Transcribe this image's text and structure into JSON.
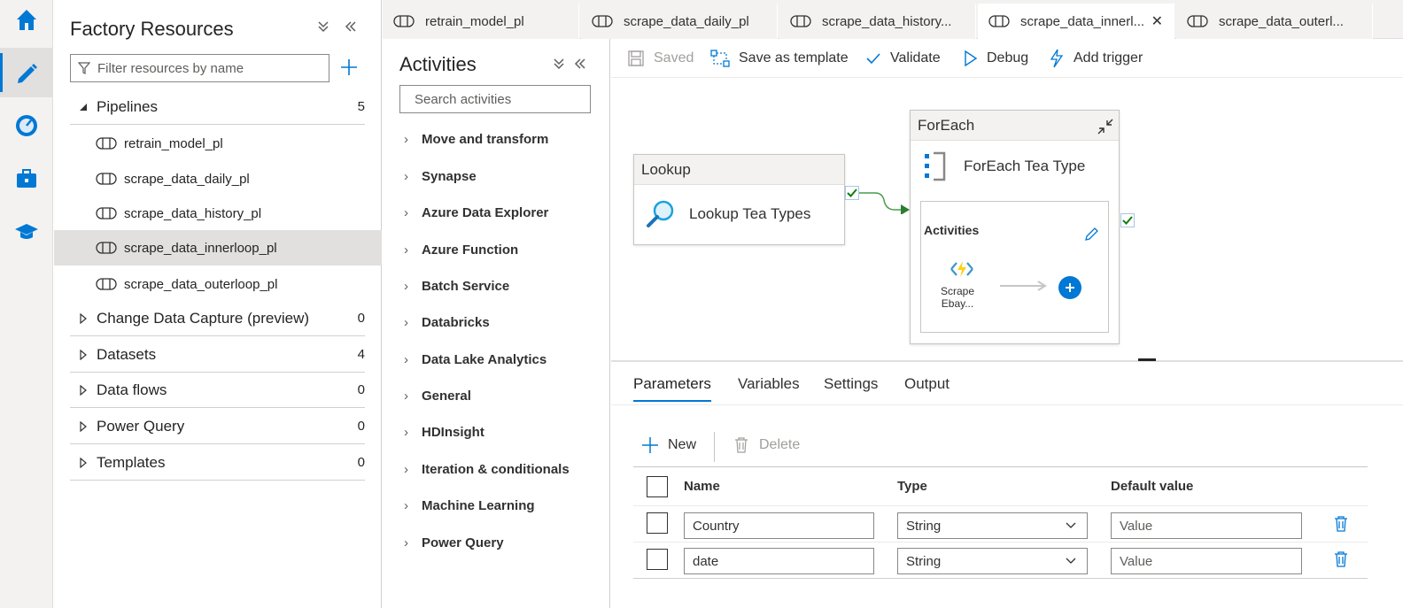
{
  "resources": {
    "title": "Factory Resources",
    "filter_placeholder": "Filter resources by name",
    "pipelines": {
      "label": "Pipelines",
      "count": "5",
      "items": [
        "retrain_model_pl",
        "scrape_data_daily_pl",
        "scrape_data_history_pl",
        "scrape_data_innerloop_pl",
        "scrape_data_outerloop_pl"
      ]
    },
    "categories": [
      {
        "label": "Change Data Capture (preview)",
        "count": "0"
      },
      {
        "label": "Datasets",
        "count": "4"
      },
      {
        "label": "Data flows",
        "count": "0"
      },
      {
        "label": "Power Query",
        "count": "0"
      },
      {
        "label": "Templates",
        "count": "0"
      }
    ]
  },
  "tabs": [
    "retrain_model_pl",
    "scrape_data_daily_pl",
    "scrape_data_history...",
    "scrape_data_innerl...",
    "scrape_data_outerl..."
  ],
  "activities": {
    "title": "Activities",
    "search_placeholder": "Search activities",
    "categories": [
      "Move and transform",
      "Synapse",
      "Azure Data Explorer",
      "Azure Function",
      "Batch Service",
      "Databricks",
      "Data Lake Analytics",
      "General",
      "HDInsight",
      "Iteration & conditionals",
      "Machine Learning",
      "Power Query"
    ]
  },
  "toolbar": {
    "saved": "Saved",
    "save_template": "Save as template",
    "validate": "Validate",
    "debug": "Debug",
    "add_trigger": "Add trigger"
  },
  "canvas": {
    "lookup": {
      "header": "Lookup",
      "name": "Lookup Tea Types"
    },
    "foreach": {
      "header": "ForEach",
      "name": "ForEach Tea Type",
      "inner_title": "Activities",
      "inner_activity": "Scrape Ebay..."
    }
  },
  "bottom": {
    "tabs": [
      "Parameters",
      "Variables",
      "Settings",
      "Output"
    ],
    "new_label": "New",
    "delete_label": "Delete",
    "columns": {
      "name": "Name",
      "type": "Type",
      "default": "Default value"
    },
    "rows": [
      {
        "name": "Country",
        "type": "String",
        "default_placeholder": "Value"
      },
      {
        "name": "date",
        "type": "String",
        "default_placeholder": "Value"
      }
    ]
  }
}
